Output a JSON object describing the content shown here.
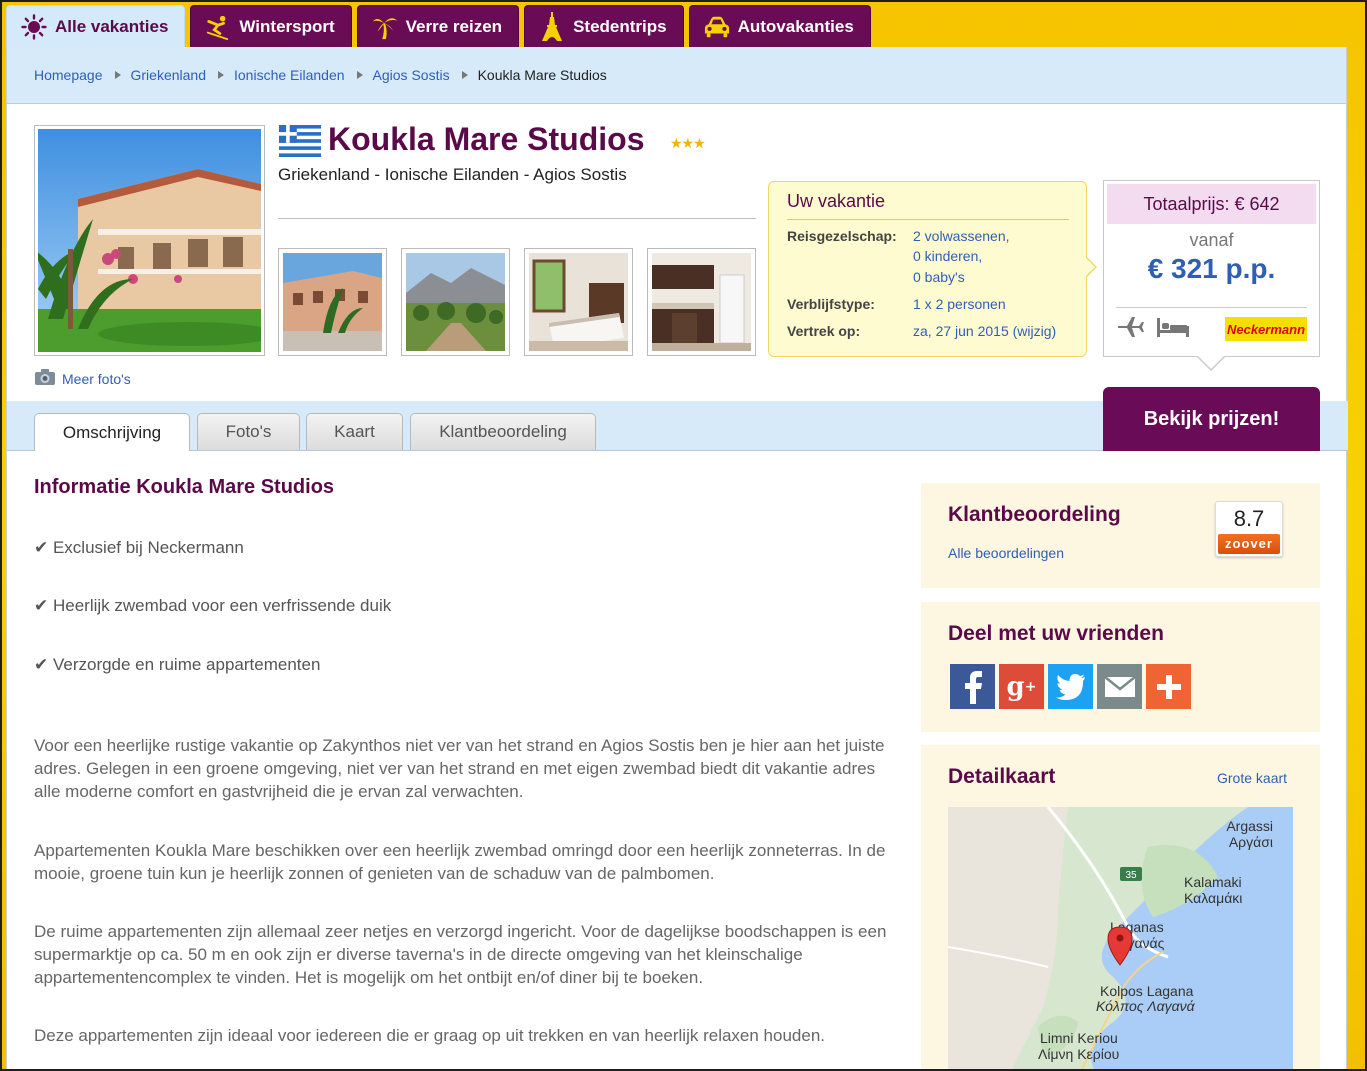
{
  "nav": {
    "tabs": [
      {
        "label": "Alle vakanties",
        "icon": "sun-icon"
      },
      {
        "label": "Wintersport",
        "icon": "skier-icon"
      },
      {
        "label": "Verre reizen",
        "icon": "palm-tree-icon"
      },
      {
        "label": "Stedentrips",
        "icon": "eiffel-tower-icon"
      },
      {
        "label": "Autovakanties",
        "icon": "car-icon"
      }
    ]
  },
  "breadcrumb": [
    "Homepage",
    "Griekenland",
    "Ionische Eilanden",
    "Agios Sostis",
    "Koukla Mare Studios"
  ],
  "hotel": {
    "name": "Koukla Mare Studios",
    "stars": 3,
    "location": "Griekenland - Ionische Eilanden - Agios Sostis",
    "more_photos": "Meer foto's"
  },
  "vacation": {
    "title": "Uw vakantie",
    "party_label": "Reisgezelschap:",
    "adults": "2 volwassenen,",
    "children": "0 kinderen,",
    "babies": "0 baby's",
    "stay_label": "Verblijfstype:",
    "stay_value": "1 x 2 personen",
    "depart_label": "Vertrek op:",
    "depart_value": "za, 27 jun 2015 (wijzig)"
  },
  "price": {
    "total": "Totaalprijs: € 642",
    "from": "vanaf",
    "per_person": "€ 321 p.p.",
    "provider_logo": "Neckermann"
  },
  "cta": "Bekijk prijzen!",
  "content_tabs": [
    "Omschrijving",
    "Foto's",
    "Kaart",
    "Klantbeoordeling"
  ],
  "info": {
    "title": "Informatie Koukla Mare Studios",
    "usps": [
      "✔ Exclusief bij Neckermann",
      "✔ Heerlijk zwembad voor een verfrissende duik",
      "✔ Verzorgde en ruime appartementen"
    ],
    "paragraphs": [
      "Voor een heerlijke rustige vakantie op Zakynthos niet ver van het strand en Agios Sostis ben je hier aan het juiste adres. Gelegen in een groene omgeving, niet ver van het strand en met eigen zwembad biedt dit vakantie adres alle moderne comfort en gastvrijheid die je ervan zal verwachten.",
      "Appartementen Koukla Mare beschikken over een heerlijk zwembad omringd door een heerlijk zonneterras. In de mooie, groene tuin kun je heerlijk zonnen of genieten van de schaduw van de palmbomen.",
      "De ruime appartementen zijn allemaal zeer netjes en verzorgd ingericht. Voor de dagelijkse boodschappen is een supermarktje op ca. 50 m en ook zijn er diverse taverna's in de directe omgeving van het kleinschalige appartementencomplex te vinden. Het is mogelijk om het ontbijt en/of diner bij te boeken.",
      "Deze appartementen zijn ideaal voor iedereen die er graag op uit trekken en van heerlijk relaxen houden."
    ]
  },
  "reviews": {
    "title": "Klantbeoordeling",
    "link": "Alle beoordelingen",
    "score": "8.7",
    "badge": "zoover"
  },
  "share": {
    "title": "Deel met uw vrienden",
    "buttons": [
      "facebook-icon",
      "google-plus-icon",
      "twitter-icon",
      "mail-icon",
      "plus-icon"
    ],
    "colors": {
      "facebook": "#3b5998",
      "google": "#dd4b39",
      "twitter": "#1da1f2",
      "mail": "#7b8a8b",
      "more": "#f06335"
    }
  },
  "map": {
    "title": "Detailkaart",
    "link": "Grote kaart",
    "labels": [
      "Argassi",
      "Αργάσι",
      "35",
      "Kalamaki",
      "Καλαμάκι",
      "Laganas",
      "Λαγανάς",
      "Kolpos Lagana",
      "Κόλπος Λαγανά",
      "Limni Keriou",
      "Λίμνη Κερίου"
    ]
  },
  "colors": {
    "brand_purple": "#5a0a48",
    "cta_purple": "#690b56",
    "link_blue": "#2f5fb5",
    "crumb_bar": "#d6eafa",
    "yellow_bg": "#f6c400"
  }
}
